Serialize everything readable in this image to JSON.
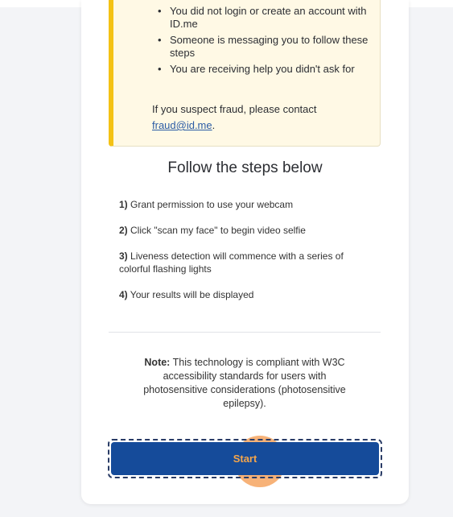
{
  "warning": {
    "bullets": [
      "You did not login or create an account with ID.me",
      "Someone is messaging you to follow these steps",
      "You are receiving help you didn't ask for"
    ],
    "fraud_text": "If you suspect fraud, please contact",
    "fraud_email": "fraud@id.me",
    "fraud_suffix": "."
  },
  "steps_heading": "Follow the steps below",
  "steps": [
    {
      "num": "1)",
      "text": "Grant permission to use your webcam"
    },
    {
      "num": "2)",
      "text": "Click \"scan my face\" to begin video selfie"
    },
    {
      "num": "3)",
      "text": "Liveness detection will commence with a series of colorful flashing lights"
    },
    {
      "num": "4)",
      "text": "Your results will be displayed"
    }
  ],
  "note": {
    "label": "Note:",
    "text": "This technology is compliant with W3C accessibility standards for users with photosensitive considerations (photosensitive epilepsy)."
  },
  "start_button": {
    "label": "Start"
  },
  "colors": {
    "accent": "#154b9a",
    "warning_border": "#f4c215",
    "warning_bg": "#fff9e5"
  }
}
